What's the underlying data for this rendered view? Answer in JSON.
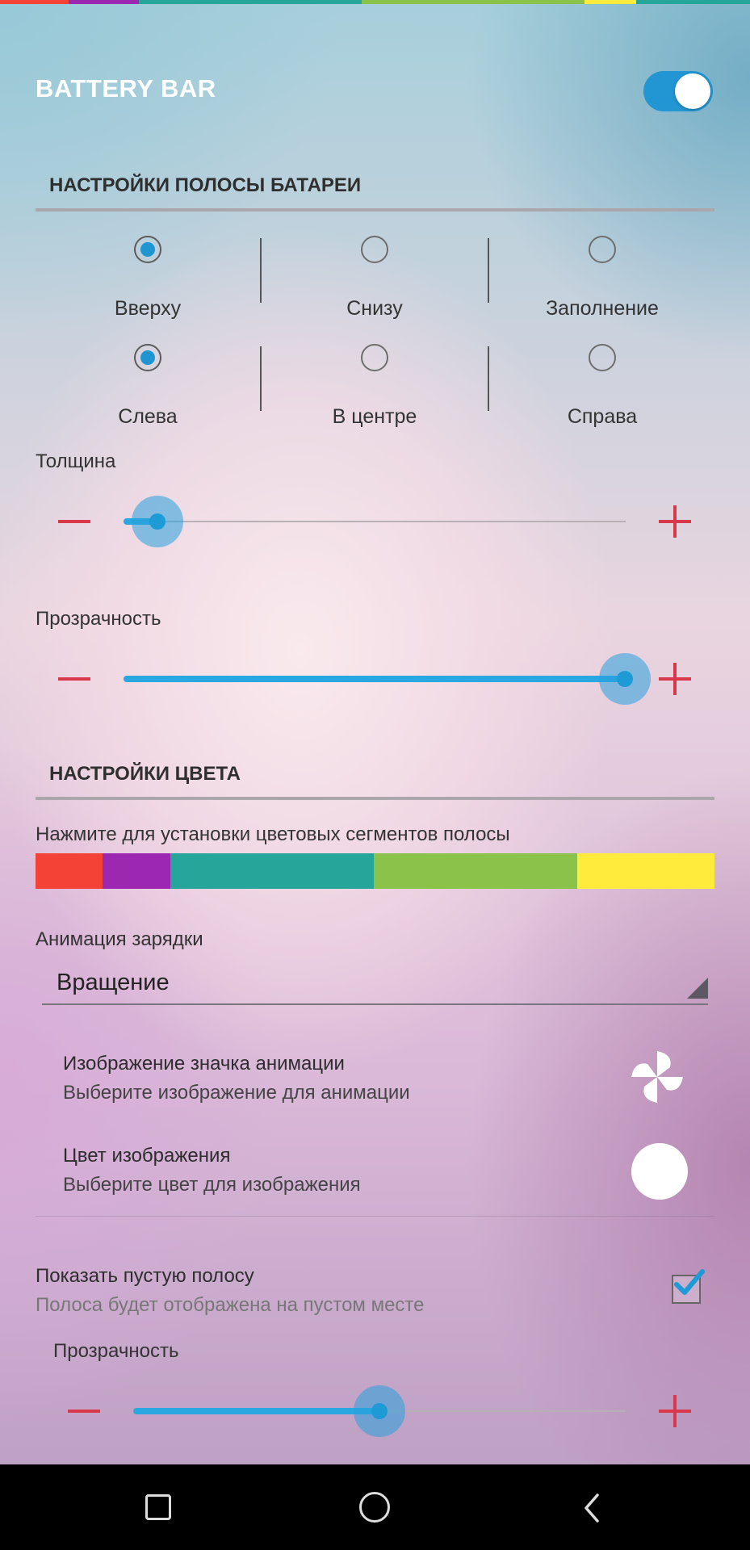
{
  "header": {
    "title": "BATTERY BAR",
    "enabled": true
  },
  "top_strip_colors": [
    "#f44336",
    "#9c27b0",
    "#26a69a",
    "#8bc34a",
    "#ffeb3b",
    "#26a69a"
  ],
  "bar_settings": {
    "section_title": "НАСТРОЙКИ ПОЛОСЫ БАТАРЕИ",
    "position_options": [
      {
        "label": "Вверху",
        "selected": true
      },
      {
        "label": "Снизу",
        "selected": false
      },
      {
        "label": "Заполнение",
        "selected": false
      }
    ],
    "alignment_options": [
      {
        "label": "Слева",
        "selected": true
      },
      {
        "label": "В центре",
        "selected": false
      },
      {
        "label": "Справа",
        "selected": false
      }
    ],
    "thickness": {
      "label": "Толщина",
      "value_fraction": 0.06
    },
    "transparency": {
      "label": "Прозрачность",
      "value_fraction": 1.0
    }
  },
  "color_settings": {
    "section_title": "НАСТРОЙКИ ЦВЕТА",
    "segments_hint": "Нажмите для установки цветовых сегментов полосы",
    "segments": [
      {
        "color": "#f44336",
        "weight": 1
      },
      {
        "color": "#9c27b0",
        "weight": 1
      },
      {
        "color": "#26a69a",
        "weight": 3
      },
      {
        "color": "#8bc34a",
        "weight": 3
      },
      {
        "color": "#ffeb3b",
        "weight": 2
      }
    ],
    "charge_animation": {
      "label": "Анимация зарядки",
      "value": "Вращение"
    },
    "animation_icon": {
      "title": "Изображение значка анимации",
      "subtitle": "Выберите изображение для анимации",
      "icon": "pinwheel-icon"
    },
    "image_color": {
      "title": "Цвет изображения",
      "subtitle": "Выберите цвет для изображения",
      "color": "#ffffff"
    },
    "show_empty_bar": {
      "title": "Показать пустую полосу",
      "subtitle": "Полоса будет отображена на пустом месте",
      "checked": true
    },
    "empty_transparency": {
      "label": "Прозрачность",
      "value_fraction": 0.5
    }
  },
  "navbar": {
    "icons": [
      "recent-apps-icon",
      "home-icon",
      "back-icon"
    ]
  }
}
